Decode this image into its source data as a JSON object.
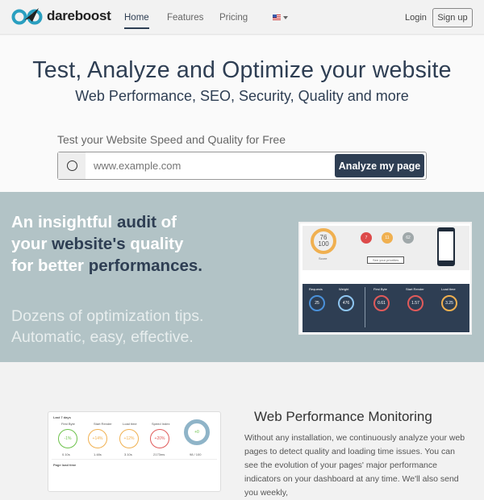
{
  "header": {
    "brand": "dareboost",
    "nav": [
      "Home",
      "Features",
      "Pricing"
    ],
    "active": "Home",
    "language": "en-US",
    "login": "Login",
    "signup": "Sign up"
  },
  "hero": {
    "title": "Test, Analyze and Optimize your website",
    "subtitle": "Web Performance, SEO, Security, Quality and more",
    "form_label": "Test your Website Speed and Quality for Free",
    "url_placeholder": "www.example.com",
    "analyze_button": "Analyze my page"
  },
  "audit": {
    "line1a": "An insightful ",
    "line1b": "audit",
    "line1c": " of",
    "line2a": "your ",
    "line2b": "website's",
    "line2c": " quality",
    "line3a": "for better ",
    "line3b": "performances.",
    "sub1": "Dozens of optimization tips.",
    "sub2": "Automatic, easy, effective.",
    "report": {
      "score": "76",
      "score_max": "100",
      "score_label": "Score",
      "issues": "7",
      "improvements": "11",
      "successes": "62",
      "priorities": "See your priorities",
      "requests_label": "Requests",
      "weight_label": "Weight",
      "first_byte_label": "First Byte",
      "start_render_label": "Start Render",
      "load_time_label": "Load time",
      "requests": "25",
      "weight": "476",
      "first_byte": "0.61",
      "start_render": "1.57",
      "load_time": "3.25"
    }
  },
  "monitoring": {
    "title": "Web Performance Monitoring",
    "text": "Without any installation, we continuously analyze your web pages to detect quality and loading time issues. You can see the evolution of your pages' major performance indicators on your dashboard at any time. We'll also send you weekly,",
    "dashboard": {
      "period": "Last 7 days",
      "metrics": [
        {
          "label": "First Byte",
          "change": "-1%",
          "value": "0.10s",
          "color": "#6cc24a"
        },
        {
          "label": "Start Render",
          "change": "+14%",
          "value": "1.48s",
          "color": "#f0b050"
        },
        {
          "label": "Load time",
          "change": "+12%",
          "value": "3.10s",
          "color": "#f0b050"
        },
        {
          "label": "Speed Index",
          "change": "+20%",
          "value": "2173ms",
          "color": "#e05a5a"
        }
      ],
      "score_change": "+0",
      "score": "98 / 100",
      "chart_title": "Page load time"
    }
  }
}
